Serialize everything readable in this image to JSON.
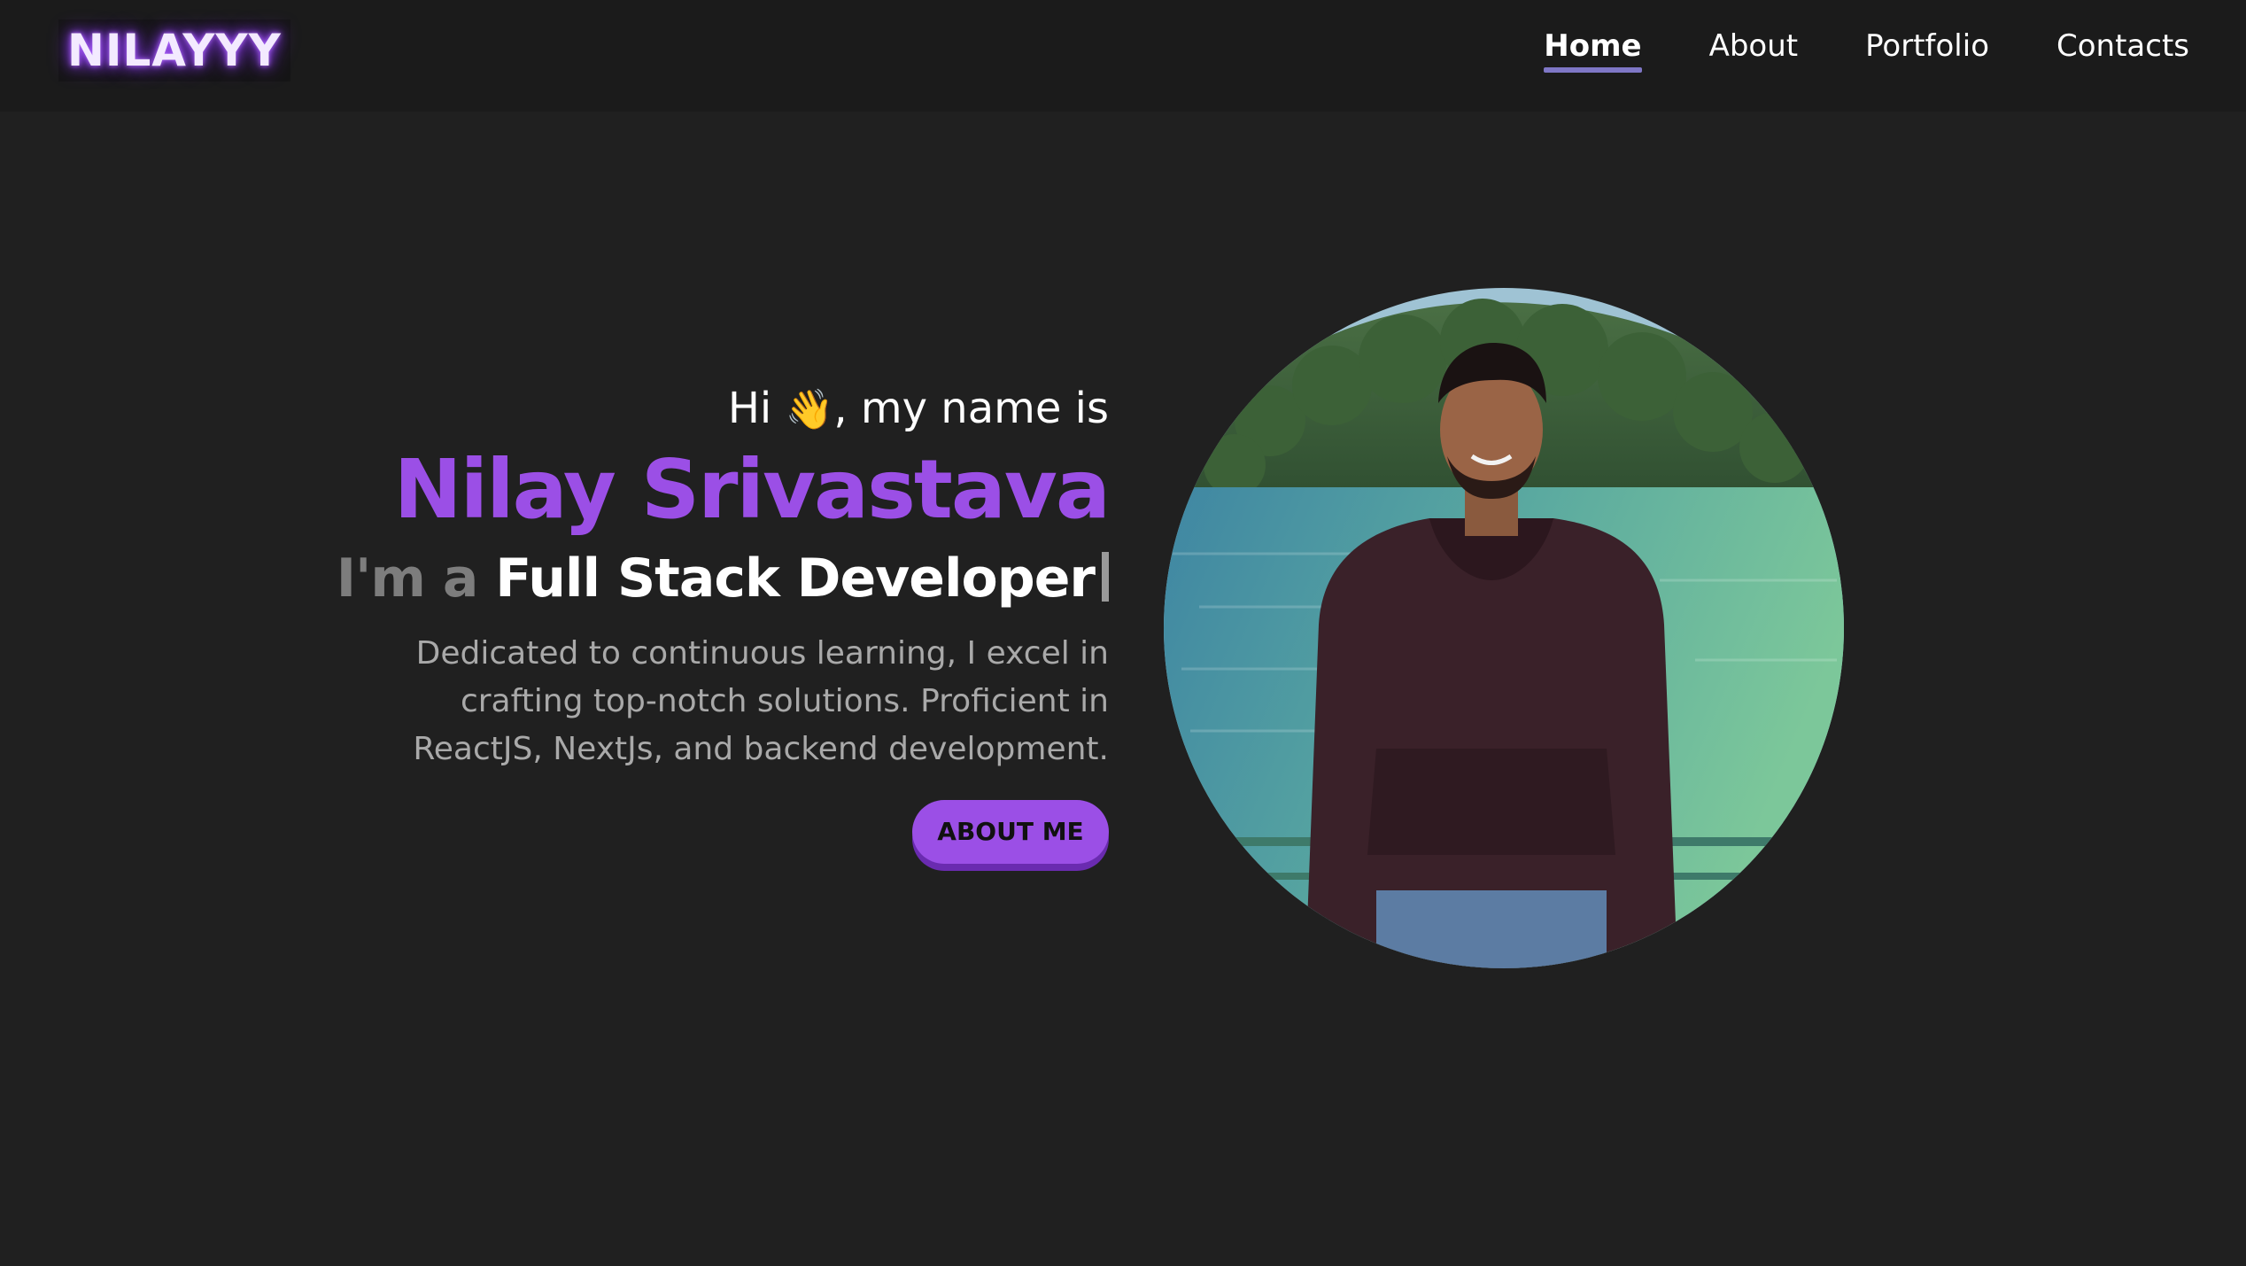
{
  "header": {
    "logo": "NILAYYY",
    "nav": [
      {
        "label": "Home",
        "active": true
      },
      {
        "label": "About",
        "active": false
      },
      {
        "label": "Portfolio",
        "active": false
      },
      {
        "label": "Contacts",
        "active": false
      }
    ]
  },
  "hero": {
    "greeting_prefix": "Hi",
    "wave_emoji": "👋",
    "greeting_suffix": ", my name is",
    "name": "Nilay Srivastava",
    "role_prefix": "I'm a",
    "role_title": "Full Stack Developer",
    "description_lines": [
      "Dedicated to continuous learning, I excel in",
      "crafting top-notch solutions. Proficient in",
      "ReactJS, NextJs, and backend development."
    ],
    "button_label": "ABOUT ME"
  },
  "colors": {
    "background": "#202020",
    "navbar": "#1b1b1b",
    "accent": "#9b4fe6",
    "nav_underline": "#7f77c6",
    "muted_text": "#a9a9a9"
  }
}
